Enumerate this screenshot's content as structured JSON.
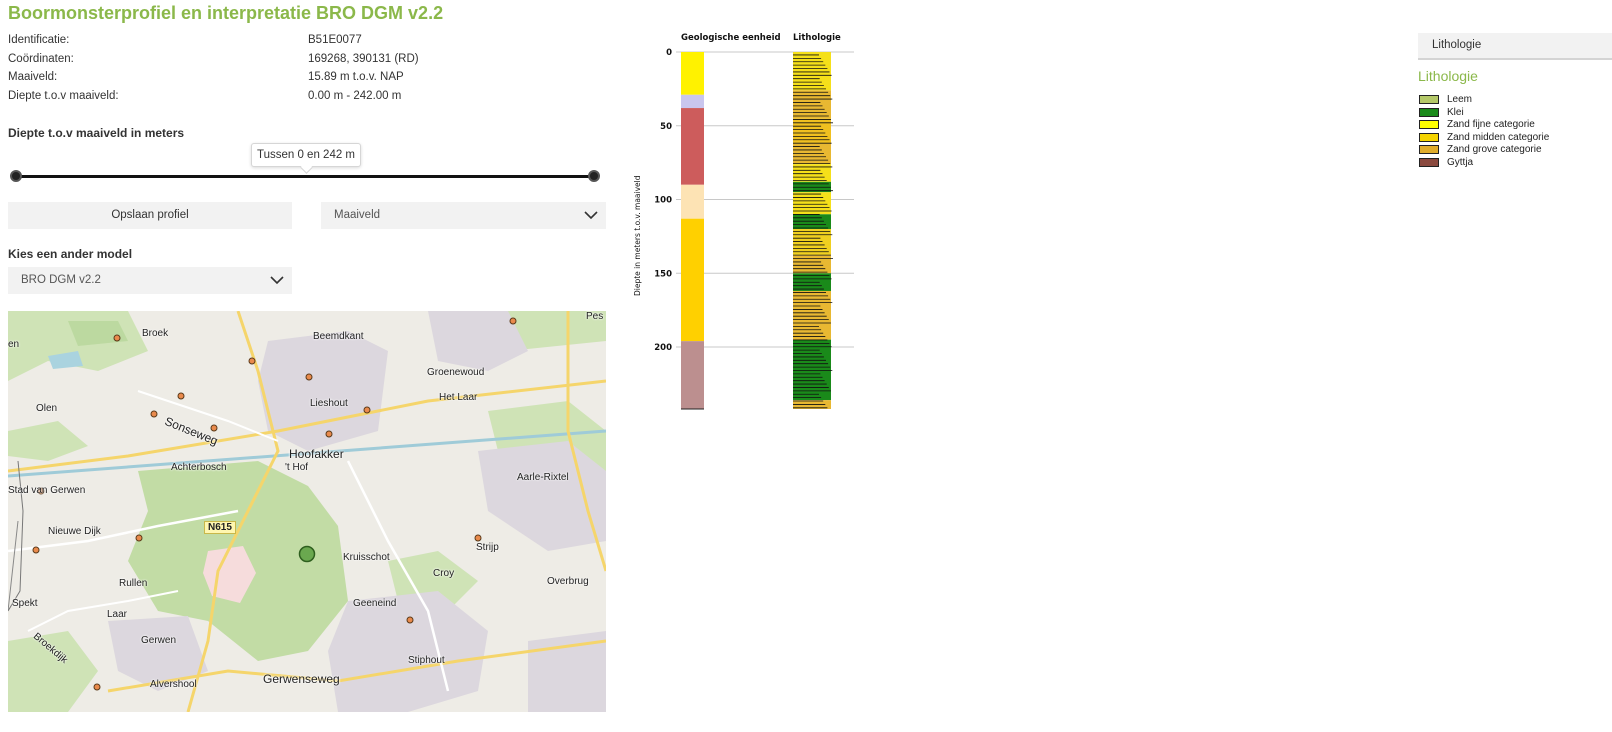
{
  "title": "Boormonsterprofiel en interpretatie BRO DGM v2.2",
  "info": [
    {
      "key": "Identificatie:",
      "value": "B51E0077"
    },
    {
      "key": "Coördinaten:",
      "value": "169268, 390131 (RD)"
    },
    {
      "key": "Maaiveld:",
      "value": "15.89 m t.o.v. NAP"
    },
    {
      "key": "Diepte t.o.v maaiveld:",
      "value": "0.00 m - 242.00 m"
    }
  ],
  "depth_filter": {
    "label": "Diepte t.o.v maaiveld in meters",
    "tooltip": "Tussen 0 en 242 m",
    "min": 0,
    "max": 242,
    "range_min": 0,
    "range_max": 242
  },
  "buttons": {
    "save_profile": "Opslaan profiel"
  },
  "reference_select": {
    "selected": "Maaiveld"
  },
  "model_select": {
    "label": "Kies een ander model",
    "selected": "BRO DGM v2.2"
  },
  "map": {
    "labels": [
      "Broek",
      "Beemdkant",
      "Groenewoud",
      "Het Laar",
      "Lieshout",
      "Olen",
      "Sonseweg",
      "Achterbosch",
      "'t Hof",
      "Hoofakker",
      "Aarle-Rixtel",
      "Stad van Gerwen",
      "Nieuwe Dijk",
      "N615",
      "Kruisschot",
      "Strijp",
      "Croy",
      "Overbrug",
      "Rullen",
      "Spekt",
      "Laar",
      "Geeneind",
      "Gerwen",
      "Broekdijk",
      "Stiphout",
      "Alvershool",
      "Gerwenseweg",
      "en",
      "Pes"
    ]
  },
  "chart_data": {
    "type": "table",
    "ylabel": "Diepte in meters t.o.v. maaiveld",
    "ylim": [
      0,
      242
    ],
    "yticks": [
      0,
      50,
      100,
      150,
      200
    ],
    "columns": [
      "Geologische eenheid",
      "Lithologie"
    ],
    "geologische_eenheid": [
      {
        "from": 0,
        "to": 29,
        "color": "#fff200"
      },
      {
        "from": 29,
        "to": 38,
        "color": "#c9c6ee"
      },
      {
        "from": 38,
        "to": 90,
        "color": "#cd5c5c"
      },
      {
        "from": 90,
        "to": 113,
        "color": "#fde3b4"
      },
      {
        "from": 113,
        "to": 196,
        "color": "#ffd000"
      },
      {
        "from": 196,
        "to": 242,
        "color": "#bc8f8f"
      }
    ],
    "lithologie": [
      {
        "from": 0,
        "to": 26,
        "color": "#f5e01a"
      },
      {
        "from": 26,
        "to": 45,
        "color": "#e8b832"
      },
      {
        "from": 45,
        "to": 62,
        "color": "#f0c020"
      },
      {
        "from": 62,
        "to": 76,
        "color": "#e8b832"
      },
      {
        "from": 76,
        "to": 88,
        "color": "#f5e01a"
      },
      {
        "from": 88,
        "to": 95,
        "color": "#1a8a1a"
      },
      {
        "from": 95,
        "to": 110,
        "color": "#f5e01a"
      },
      {
        "from": 110,
        "to": 120,
        "color": "#1a8a1a"
      },
      {
        "from": 120,
        "to": 138,
        "color": "#f0d020"
      },
      {
        "from": 138,
        "to": 150,
        "color": "#e8b832"
      },
      {
        "from": 150,
        "to": 162,
        "color": "#1a8a1a"
      },
      {
        "from": 162,
        "to": 195,
        "color": "#e8b832"
      },
      {
        "from": 195,
        "to": 236,
        "color": "#1a8a1a"
      },
      {
        "from": 236,
        "to": 242,
        "color": "#e8b832"
      }
    ]
  },
  "legend": {
    "tab": "Lithologie",
    "title": "Lithologie",
    "items": [
      {
        "label": "Leem",
        "color": "#b5c969"
      },
      {
        "label": "Klei",
        "color": "#1a8a1a"
      },
      {
        "label": "Zand fijne categorie",
        "color": "#ffff00"
      },
      {
        "label": "Zand midden categorie",
        "color": "#f5d400"
      },
      {
        "label": "Zand grove categorie",
        "color": "#e0ad2c"
      },
      {
        "label": "Gyttja",
        "color": "#8b4a3f"
      }
    ]
  }
}
